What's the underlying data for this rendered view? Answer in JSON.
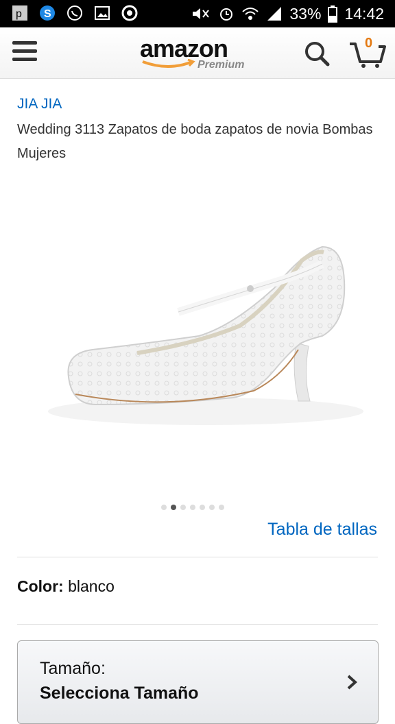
{
  "status_bar": {
    "battery": "33%",
    "time": "14:42",
    "left_icons": [
      "p-icon",
      "skype-icon",
      "whatsapp-icon",
      "gallery-icon",
      "circle-app-icon"
    ],
    "right_icons": [
      "mute-icon",
      "alarm-icon",
      "wifi-icon",
      "signal-icon",
      "battery-icon"
    ]
  },
  "header": {
    "logo_text": "amazon",
    "logo_sub": "Premium",
    "cart_count": "0"
  },
  "product": {
    "brand": "JIA JIA",
    "title": "Wedding 3113 Zapatos de boda zapatos de novia Bombas Mujeres",
    "image_alt": "white lace heel shoe",
    "image_count": 7,
    "active_image_index": 1,
    "size_chart_link": "Tabla de tallas",
    "color_label": "Color:",
    "color_value": "blanco",
    "size_label": "Tamaño:",
    "size_value": "Selecciona Tamaño"
  },
  "colors": {
    "link": "#0066c0",
    "cart_badge": "#e47911",
    "status_bar_bg": "#000000"
  }
}
